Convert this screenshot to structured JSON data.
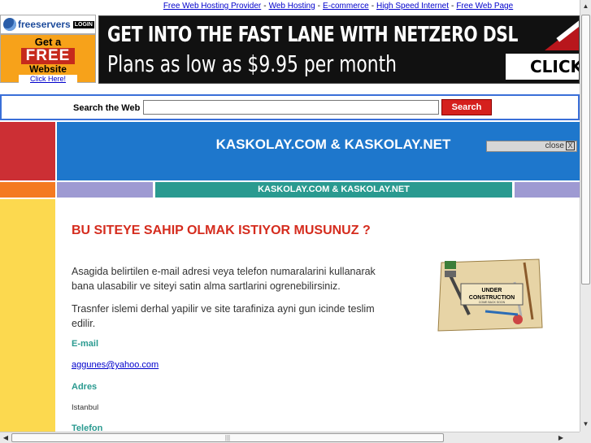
{
  "top_links": [
    "Free Web Hosting Provider",
    "Web Hosting",
    "E-commerce",
    "High Speed Internet",
    "Free Web Page"
  ],
  "top_links_separator": "-",
  "freeservers": {
    "brand": "freeservers",
    "login": "LOGIN",
    "get_a": "Get a",
    "free": "FREE",
    "website": "Website",
    "click_here": "Click Here!"
  },
  "banner": {
    "line1": "GET INTO THE FAST LANE WITH NETZERO DSL",
    "line2": "Plans as low as $9.95 per month",
    "cta": "CLICK HE"
  },
  "search": {
    "label": "Search the Web",
    "value": "",
    "button": "Search"
  },
  "site": {
    "title": "KASKOLAY.COM & KASKOLAY.NET",
    "close_label": "close",
    "close_x": "X",
    "nav_title": "KASKOLAY.COM & KASKOLAY.NET"
  },
  "content": {
    "heading": "BU SITEYE SAHIP OLMAK ISTIYOR MUSUNUZ ?",
    "paragraph1": "Asagida belirtilen e-mail adresi veya telefon numaralarini kullanarak bana ulasabilir ve siteyi satin alma sartlarini ogrenebilirsiniz.",
    "paragraph2": "Trasnfer islemi derhal yapilir ve site tarafiniza ayni gun icinde teslim edilir.",
    "email_label": "E-mail",
    "email": "aggunes@yahoo.com",
    "address_label": "Adres",
    "address": "Istanbul",
    "phone_label": "Telefon",
    "uc_line1": "UNDER",
    "uc_line2": "CONSTRUCTION",
    "uc_line3": "COME BACK SOON"
  },
  "colors": {
    "header_blue": "#1e77cc",
    "header_red": "#cc2f34",
    "heading_red": "#d52c1e",
    "teal": "#2a9a90",
    "yellow": "#fcd94f",
    "orange": "#f47a21",
    "purple": "#9e9ad2"
  },
  "scrollbars": {
    "up_arrow": "▲",
    "down_arrow": "▼",
    "left_arrow": "◀",
    "right_arrow": "▶",
    "grip": "|||"
  }
}
